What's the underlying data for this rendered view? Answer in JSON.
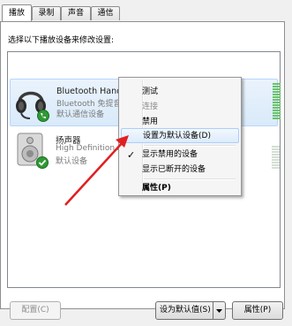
{
  "tabs": [
    {
      "label": "播放",
      "active": true
    },
    {
      "label": "录制",
      "active": false
    },
    {
      "label": "声音",
      "active": false
    },
    {
      "label": "通信",
      "active": false
    }
  ],
  "instruction": "选择以下播放设备来修改设置:",
  "devices": [
    {
      "name": "Bluetooth Hands-free Audio",
      "description": "Bluetooth 免提音频设备",
      "status": "默认通信设备",
      "icon": "headset-icon",
      "badge": "phone-badge-icon",
      "selected": true
    },
    {
      "name": "扬声器",
      "description": "High Definition A",
      "status": "默认设备",
      "icon": "speaker-icon",
      "badge": "checkmark-badge-icon",
      "selected": false
    }
  ],
  "context_menu": {
    "items": [
      {
        "label": "测试",
        "enabled": true
      },
      {
        "label": "连接",
        "enabled": false
      },
      {
        "label": "禁用",
        "enabled": true
      },
      {
        "label": "设置为默认设备(D)",
        "enabled": true,
        "highlighted": true
      },
      {
        "label": "显示禁用的设备",
        "enabled": true,
        "checked": true
      },
      {
        "label": "显示已断开的设备",
        "enabled": true
      },
      {
        "label": "属性(P)",
        "enabled": true,
        "bold": true
      }
    ]
  },
  "buttons": {
    "configure": "配置(C)",
    "set_default": "设为默认值(S)",
    "properties": "属性(P)"
  },
  "colors": {
    "annotation_arrow": "#e02020",
    "meter_active": "#6bc36b",
    "selection": "#d9eafa"
  }
}
